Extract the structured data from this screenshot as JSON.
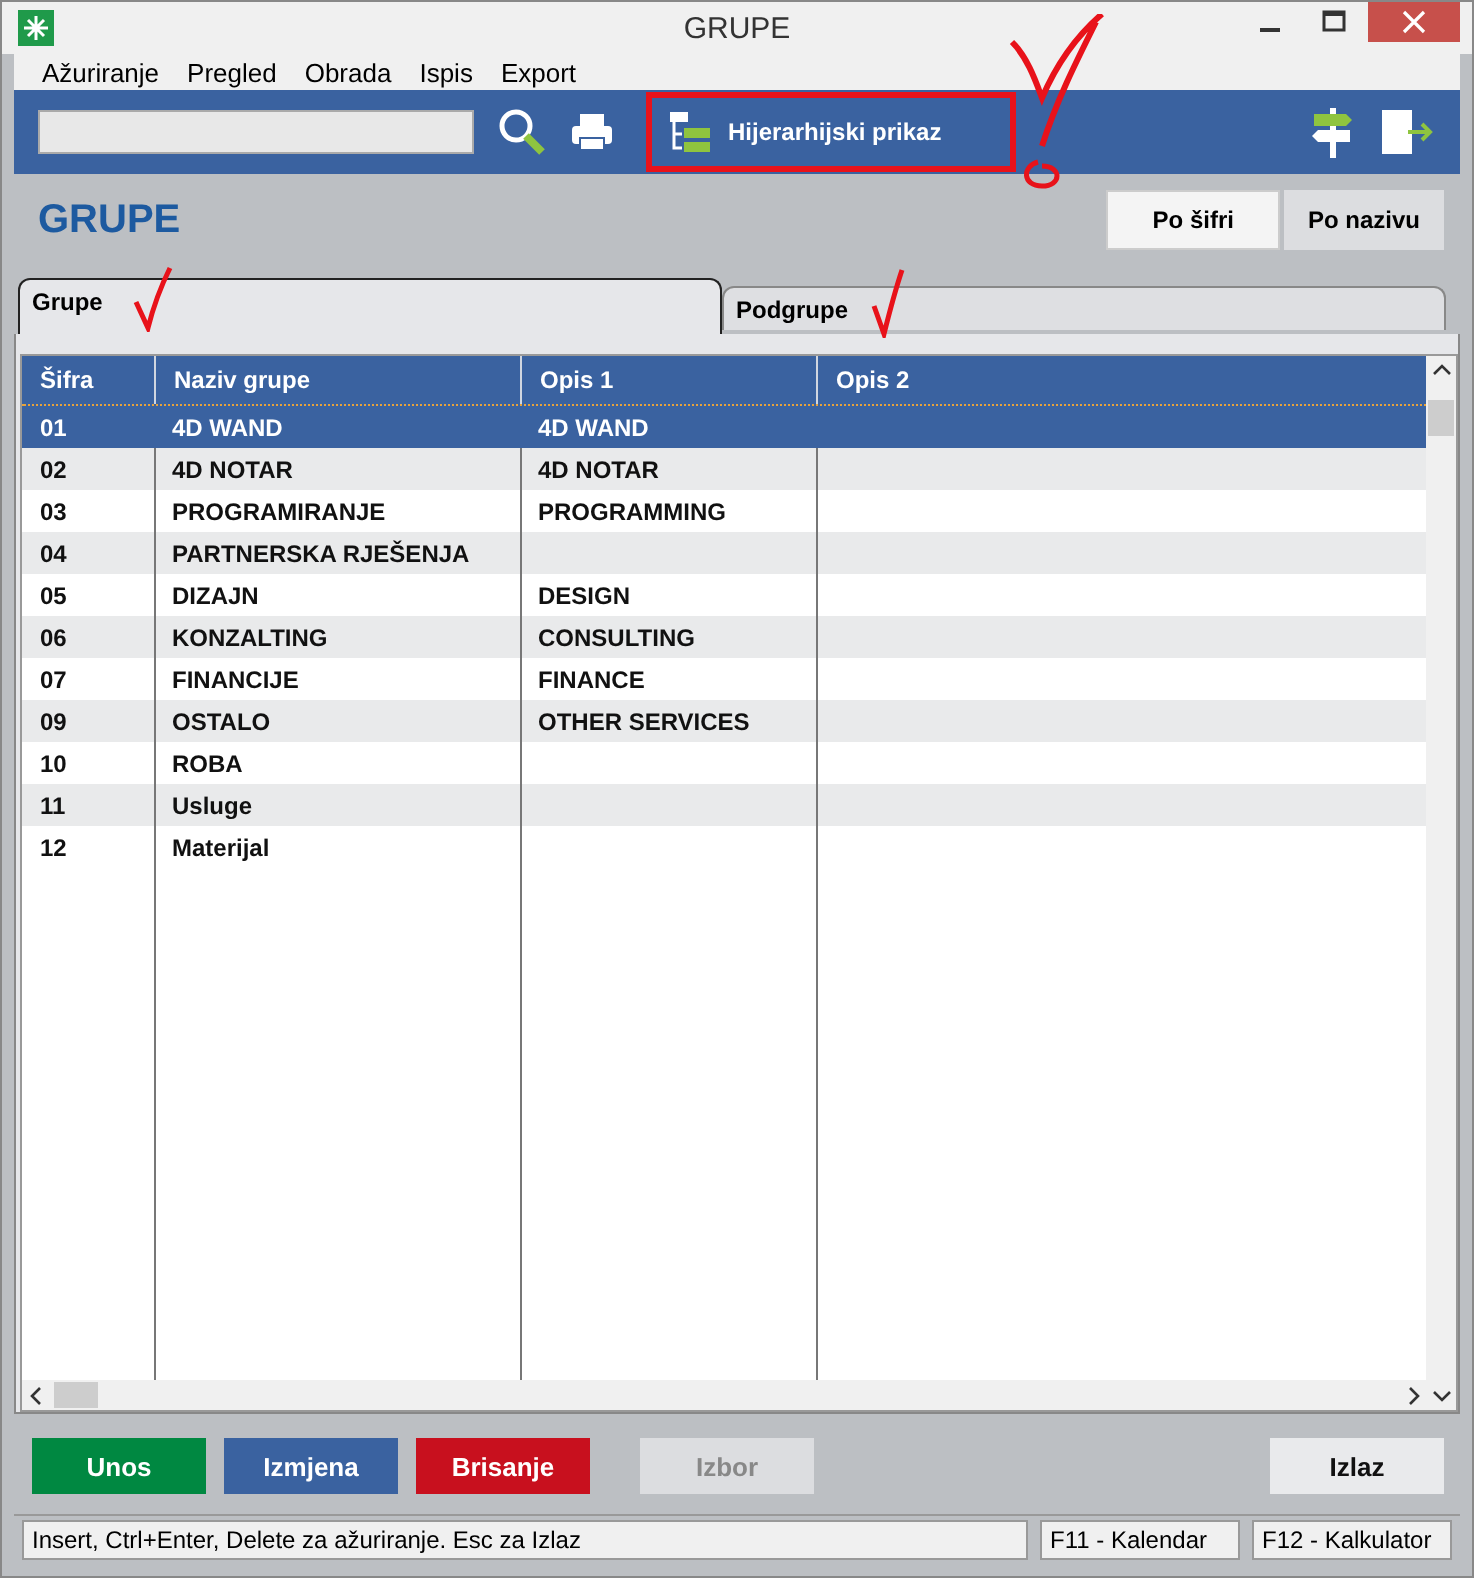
{
  "window": {
    "title": "GRUPE"
  },
  "menu": [
    "Ažuriranje",
    "Pregled",
    "Obrada",
    "Ispis",
    "Export"
  ],
  "toolbar": {
    "hierarchy_button": "Hijerarhijski prikaz"
  },
  "heading": "GRUPE",
  "sort_buttons": [
    {
      "label": "Po šifri",
      "selected": true
    },
    {
      "label": "Po nazivu",
      "selected": false
    }
  ],
  "tabs": [
    {
      "label": "Grupe",
      "selected": true
    },
    {
      "label": "Podgrupe",
      "selected": false
    }
  ],
  "table": {
    "columns": [
      "Šifra",
      "Naziv grupe",
      "Opis 1",
      "Opis 2"
    ],
    "rows": [
      {
        "cells": [
          "01",
          "4D WAND",
          "4D WAND",
          ""
        ],
        "selected": true
      },
      {
        "cells": [
          "02",
          "4D NOTAR",
          "4D NOTAR",
          ""
        ],
        "selected": false
      },
      {
        "cells": [
          "03",
          "PROGRAMIRANJE",
          "PROGRAMMING",
          ""
        ],
        "selected": false
      },
      {
        "cells": [
          "04",
          "PARTNERSKA RJEŠENJA",
          "",
          ""
        ],
        "selected": false
      },
      {
        "cells": [
          "05",
          "DIZAJN",
          "DESIGN",
          ""
        ],
        "selected": false
      },
      {
        "cells": [
          "06",
          "KONZALTING",
          "CONSULTING",
          ""
        ],
        "selected": false
      },
      {
        "cells": [
          "07",
          "FINANCIJE",
          "FINANCE",
          ""
        ],
        "selected": false
      },
      {
        "cells": [
          "09",
          "OSTALO",
          "OTHER SERVICES",
          ""
        ],
        "selected": false
      },
      {
        "cells": [
          "10",
          "ROBA",
          "",
          ""
        ],
        "selected": false
      },
      {
        "cells": [
          "11",
          "Usluge",
          "",
          ""
        ],
        "selected": false
      },
      {
        "cells": [
          "12",
          "Materijal",
          "",
          ""
        ],
        "selected": false
      }
    ]
  },
  "buttons": [
    {
      "label": "Unos",
      "kind": "green",
      "disabled": false
    },
    {
      "label": "Izmjena",
      "kind": "blue",
      "disabled": false
    },
    {
      "label": "Brisanje",
      "kind": "red",
      "disabled": false
    },
    {
      "label": "Izbor",
      "kind": "grey",
      "disabled": true
    },
    {
      "label": "Izlaz",
      "kind": "exit",
      "disabled": false
    }
  ],
  "status_bar": [
    "Insert, Ctrl+Enter, Delete za ažuriranje. Esc za Izlaz",
    "F11 - Kalendar",
    "F12 - Kalkulator"
  ]
}
